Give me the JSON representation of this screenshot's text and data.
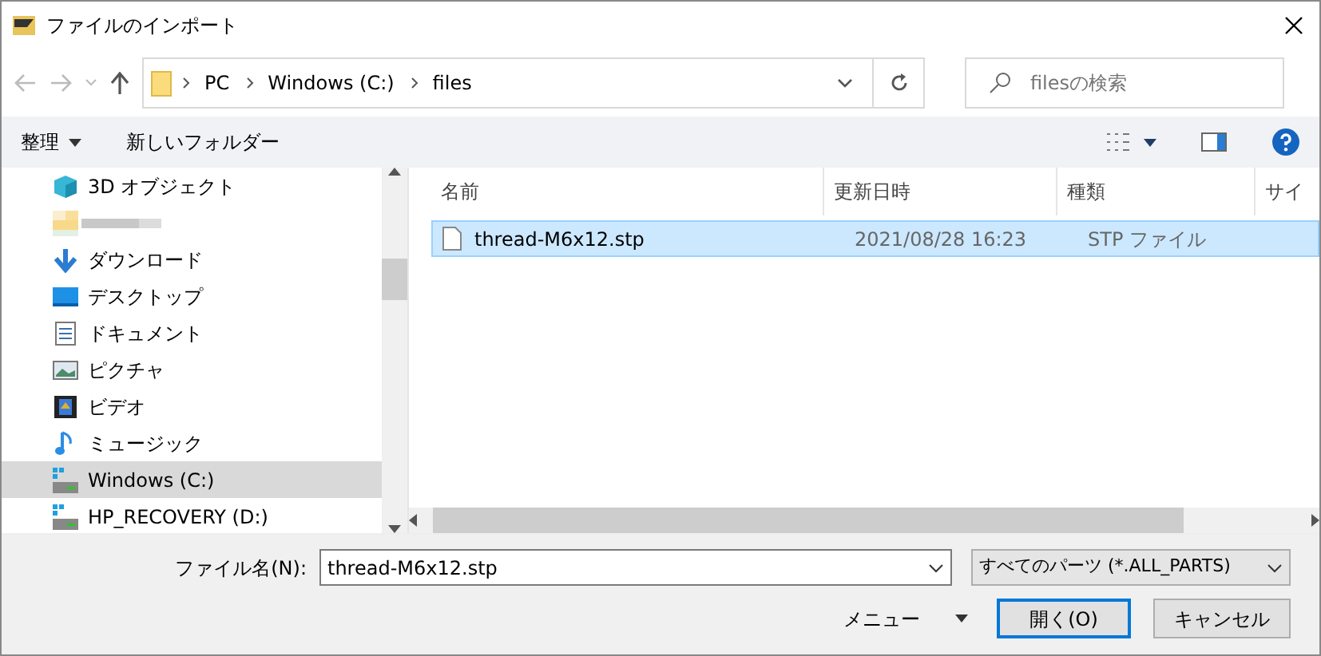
{
  "window": {
    "title": "ファイルのインポート"
  },
  "address": {
    "path": [
      "PC",
      "Windows (C:)",
      "files"
    ]
  },
  "search": {
    "placeholder": "filesの検索"
  },
  "toolbar": {
    "organize": "整理",
    "new_folder": "新しいフォルダー"
  },
  "sidebar": {
    "items": [
      {
        "kind": "cube",
        "label": "3D オブジェクト",
        "selected": false
      },
      {
        "kind": "redacted",
        "selected": false
      },
      {
        "kind": "download",
        "label": "ダウンロード",
        "selected": false
      },
      {
        "kind": "desktop",
        "label": "デスクトップ",
        "selected": false
      },
      {
        "kind": "document",
        "label": "ドキュメント",
        "selected": false
      },
      {
        "kind": "picture",
        "label": "ピクチャ",
        "selected": false
      },
      {
        "kind": "video",
        "label": "ビデオ",
        "selected": false
      },
      {
        "kind": "music",
        "label": "ミュージック",
        "selected": false
      },
      {
        "kind": "drive",
        "label": "Windows (C:)",
        "selected": true
      },
      {
        "kind": "drive",
        "label": "HP_RECOVERY (D:)",
        "selected": false
      }
    ]
  },
  "columns": [
    "名前",
    "更新日時",
    "種類",
    "サイ"
  ],
  "files": [
    {
      "name": "thread-M6x12.stp",
      "modified": "2021/08/28 16:23",
      "type": "STP ファイル",
      "selected": true
    }
  ],
  "footer": {
    "filename_label": "ファイル名(N):",
    "filename": "thread-M6x12.stp",
    "filter": "すべてのパーツ (*.ALL_PARTS)",
    "menu": "メニュー",
    "open": "開く(O)",
    "cancel": "キャンセル"
  }
}
